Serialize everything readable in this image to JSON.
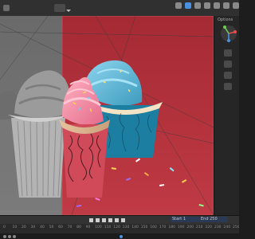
{
  "app": {
    "name": "Blender"
  },
  "sidebar": {
    "label": "Options"
  },
  "timeline": {
    "start_label": "Start",
    "start_value": "1",
    "end_label": "End",
    "end_value": "250",
    "frame_ticks": [
      "0",
      "10",
      "20",
      "30",
      "40",
      "50",
      "60",
      "70",
      "80",
      "90",
      "100",
      "110",
      "120",
      "130",
      "140",
      "150",
      "160",
      "170",
      "180",
      "190",
      "200",
      "210",
      "220",
      "230",
      "240",
      "250"
    ],
    "playhead_frame": "120"
  },
  "colors": {
    "accent": "#4a8fe0",
    "render_overlay": "#b2303a",
    "frosting_pink": "#f07e9a",
    "frosting_blue": "#66b9d8",
    "wrapper": "#e7c8a7"
  }
}
